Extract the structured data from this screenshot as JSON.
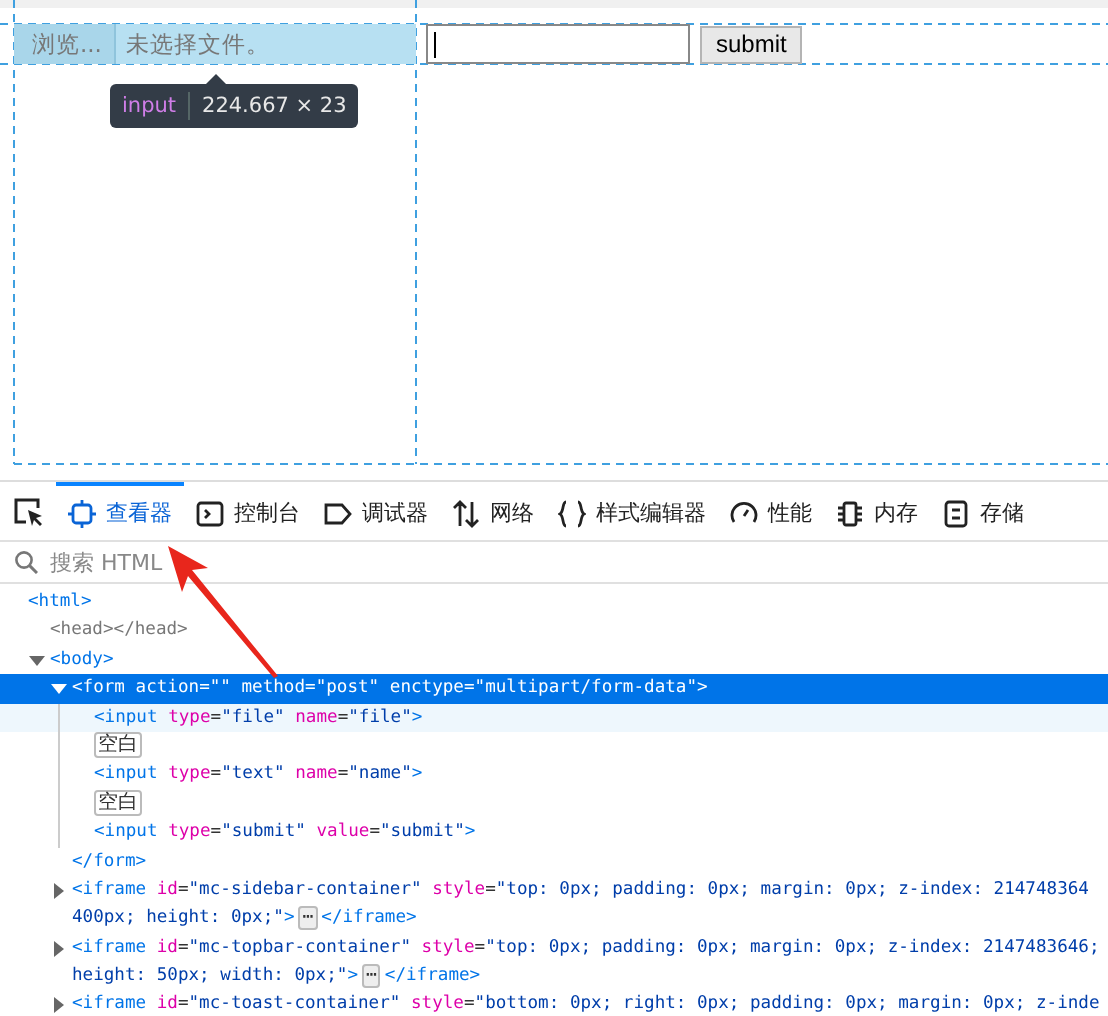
{
  "page": {
    "file_input": {
      "button": "浏览...",
      "status": "未选择文件。",
      "highlighted": true
    },
    "tooltip": {
      "tag": "input",
      "size": "224.667 × 23"
    },
    "submit_button": "submit"
  },
  "devtools": {
    "tabs": [
      {
        "label": "查看器",
        "kind": "inspector",
        "selected": true
      },
      {
        "label": "控制台",
        "kind": "console",
        "selected": false
      },
      {
        "label": "调试器",
        "kind": "debugger",
        "selected": false
      },
      {
        "label": "网络",
        "kind": "network",
        "selected": false
      },
      {
        "label": "样式编辑器",
        "kind": "style",
        "selected": false
      },
      {
        "label": "性能",
        "kind": "performance",
        "selected": false
      },
      {
        "label": "内存",
        "kind": "memory",
        "selected": false
      },
      {
        "label": "存储",
        "kind": "storage",
        "selected": false
      }
    ],
    "search": {
      "placeholder": "搜索 HTML"
    },
    "tree": [
      {
        "selected": false,
        "hovered": false,
        "lines": [
          [
            {
              "kind": "tag",
              "text": "<html>"
            }
          ]
        ],
        "children": [
          {
            "selected": false,
            "hovered": false,
            "lines": [
              [
                {
                  "kind": "dim",
                  "text": "<head></head>"
                }
              ]
            ]
          },
          {
            "selected": false,
            "hovered": false,
            "expanded": true,
            "lines": [
              [
                {
                  "kind": "tag",
                  "text": "<body>"
                }
              ]
            ],
            "children": [
              {
                "selected": true,
                "hovered": false,
                "expanded": true,
                "lines": [
                  [
                    {
                      "kind": "tag",
                      "text": "<form"
                    },
                    {
                      "kind": "attr",
                      "text": " action"
                    },
                    {
                      "kind": "plain",
                      "text": "="
                    },
                    {
                      "kind": "value",
                      "text": "\"\""
                    },
                    {
                      "kind": "attr",
                      "text": " method"
                    },
                    {
                      "kind": "plain",
                      "text": "="
                    },
                    {
                      "kind": "value",
                      "text": "\"post\""
                    },
                    {
                      "kind": "attr",
                      "text": " enctype"
                    },
                    {
                      "kind": "plain",
                      "text": "="
                    },
                    {
                      "kind": "value",
                      "text": "\"multipart/form-data\""
                    },
                    {
                      "kind": "tag",
                      "text": ">"
                    }
                  ]
                ],
                "children": [
                  {
                    "selected": false,
                    "hovered": true,
                    "lines": [
                      [
                        {
                          "kind": "tag",
                          "text": "<input"
                        },
                        {
                          "kind": "attr",
                          "text": " type"
                        },
                        {
                          "kind": "plain",
                          "text": "="
                        },
                        {
                          "kind": "value",
                          "text": "\"file\""
                        },
                        {
                          "kind": "attr",
                          "text": " name"
                        },
                        {
                          "kind": "plain",
                          "text": "="
                        },
                        {
                          "kind": "value",
                          "text": "\"file\""
                        },
                        {
                          "kind": "tag",
                          "text": ">"
                        }
                      ]
                    ]
                  },
                  {
                    "selected": false,
                    "hovered": false,
                    "lines": [
                      [
                        {
                          "kind": "badge",
                          "text": "空白"
                        }
                      ]
                    ]
                  },
                  {
                    "selected": false,
                    "hovered": false,
                    "lines": [
                      [
                        {
                          "kind": "tag",
                          "text": "<input"
                        },
                        {
                          "kind": "attr",
                          "text": " type"
                        },
                        {
                          "kind": "plain",
                          "text": "="
                        },
                        {
                          "kind": "value",
                          "text": "\"text\""
                        },
                        {
                          "kind": "attr",
                          "text": " name"
                        },
                        {
                          "kind": "plain",
                          "text": "="
                        },
                        {
                          "kind": "value",
                          "text": "\"name\""
                        },
                        {
                          "kind": "tag",
                          "text": ">"
                        }
                      ]
                    ]
                  },
                  {
                    "selected": false,
                    "hovered": false,
                    "lines": [
                      [
                        {
                          "kind": "badge",
                          "text": "空白"
                        }
                      ]
                    ]
                  },
                  {
                    "selected": false,
                    "hovered": false,
                    "lines": [
                      [
                        {
                          "kind": "tag",
                          "text": "<input"
                        },
                        {
                          "kind": "attr",
                          "text": " type"
                        },
                        {
                          "kind": "plain",
                          "text": "="
                        },
                        {
                          "kind": "value",
                          "text": "\"submit\""
                        },
                        {
                          "kind": "attr",
                          "text": " value"
                        },
                        {
                          "kind": "plain",
                          "text": "="
                        },
                        {
                          "kind": "value",
                          "text": "\"submit\""
                        },
                        {
                          "kind": "tag",
                          "text": ">"
                        }
                      ]
                    ]
                  }
                ]
              },
              {
                "selected": false,
                "hovered": false,
                "lines": [
                  [
                    {
                      "kind": "tag",
                      "text": "</form>"
                    }
                  ]
                ]
              },
              {
                "selected": false,
                "hovered": false,
                "expanded": false,
                "lines": [
                  [
                    {
                      "kind": "tag",
                      "text": "<iframe"
                    },
                    {
                      "kind": "attr",
                      "text": " id"
                    },
                    {
                      "kind": "plain",
                      "text": "="
                    },
                    {
                      "kind": "value",
                      "text": "\"mc-sidebar-container\""
                    },
                    {
                      "kind": "attr",
                      "text": " style"
                    },
                    {
                      "kind": "plain",
                      "text": "="
                    },
                    {
                      "kind": "value",
                      "text": "\"top: 0px; padding: 0px; margin: 0px; z-index: 214748364"
                    }
                  ],
                  [
                    {
                      "kind": "value",
                      "text": "400px; height: 0px;\""
                    },
                    {
                      "kind": "tag",
                      "text": ">"
                    },
                    {
                      "kind": "more",
                      "text": "⋯"
                    },
                    {
                      "kind": "tag",
                      "text": "</iframe>"
                    }
                  ]
                ]
              },
              {
                "selected": false,
                "hovered": false,
                "expanded": false,
                "lines": [
                  [
                    {
                      "kind": "tag",
                      "text": "<iframe"
                    },
                    {
                      "kind": "attr",
                      "text": " id"
                    },
                    {
                      "kind": "plain",
                      "text": "="
                    },
                    {
                      "kind": "value",
                      "text": "\"mc-topbar-container\""
                    },
                    {
                      "kind": "attr",
                      "text": " style"
                    },
                    {
                      "kind": "plain",
                      "text": "="
                    },
                    {
                      "kind": "value",
                      "text": "\"top: 0px; padding: 0px; margin: 0px; z-index: 2147483646;"
                    }
                  ],
                  [
                    {
                      "kind": "value",
                      "text": "height: 50px; width: 0px;\""
                    },
                    {
                      "kind": "tag",
                      "text": ">"
                    },
                    {
                      "kind": "more",
                      "text": "⋯"
                    },
                    {
                      "kind": "tag",
                      "text": "</iframe>"
                    }
                  ]
                ]
              },
              {
                "selected": false,
                "hovered": false,
                "expanded": false,
                "lines": [
                  [
                    {
                      "kind": "tag",
                      "text": "<iframe"
                    },
                    {
                      "kind": "attr",
                      "text": " id"
                    },
                    {
                      "kind": "plain",
                      "text": "="
                    },
                    {
                      "kind": "value",
                      "text": "\"mc-toast-container\""
                    },
                    {
                      "kind": "attr",
                      "text": " style"
                    },
                    {
                      "kind": "plain",
                      "text": "="
                    },
                    {
                      "kind": "value",
                      "text": "\"bottom: 0px; right: 0px; padding: 0px; margin: 0px; z-inde"
                    }
                  ]
                ]
              }
            ]
          }
        ]
      }
    ]
  }
}
